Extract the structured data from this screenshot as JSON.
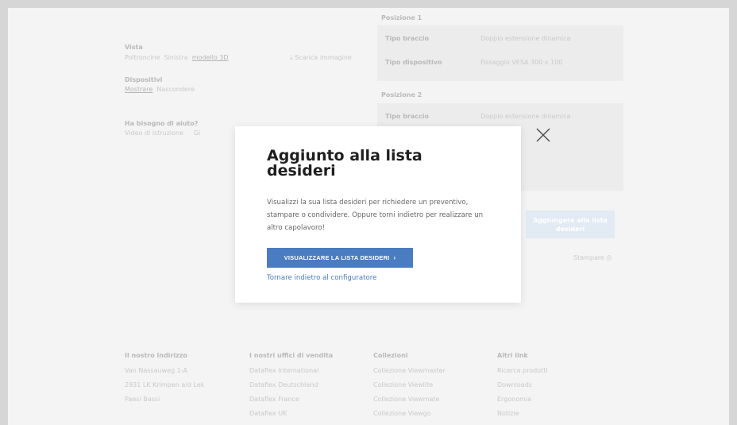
{
  "background": {
    "left": {
      "view_label": "Vista",
      "view_options": [
        "Poltroncine",
        "Sinistra",
        "modello 3D"
      ],
      "download_label": "Scarica immagine",
      "devices_label": "Dispositivi",
      "devices_options": [
        "Mostrare",
        "Nascondere"
      ],
      "help_label": "Ha bisogno di aiuto?",
      "help_options": [
        "Video di istruzione",
        "Gi"
      ]
    },
    "positions": [
      {
        "title": "Posizione 1",
        "rows": [
          {
            "key": "Tipo braccio",
            "value": "Doppio estensione dinamica"
          },
          {
            "key": "Tipo dispositivo",
            "value": "Fissaggio VESA 300 x 100"
          }
        ]
      },
      {
        "title": "Posizione 2",
        "rows": [
          {
            "key": "Tipo braccio",
            "value": "Doppio estensione dinamica"
          }
        ]
      }
    ],
    "add_button": "Aggiungere alla lista desideri",
    "print_label": "Stampare",
    "footer": [
      {
        "title": "Il nostro indirizzo",
        "items": [
          "Van Nassauweg 1-A",
          "2931 LK Krimpen a/d Lek",
          "Paesi Bassi"
        ]
      },
      {
        "title": "I nostri uffici di vendita",
        "items": [
          "Dataflex International",
          "Dataflex Deutschland",
          "Dataflex France",
          "Dataflex UK"
        ]
      },
      {
        "title": "Collezioni",
        "items": [
          "Collezione Viewmaster",
          "Collezione Viewlite",
          "Collezione Viewmate",
          "Collezione Viewgo"
        ]
      },
      {
        "title": "Altri link",
        "items": [
          "Ricerca prodotti",
          "Downloads",
          "Ergonomia",
          "Notizie"
        ]
      }
    ]
  },
  "modal": {
    "title": "Aggiunto alla lista desideri",
    "body": "Visualizzi la sua lista desideri per richiedere un preventivo, stampare o condividere. Oppure torni indietro per realizzare un altro capolavoro!",
    "cta_label": "VISUALIZZARE LA LISTA DESIDERI",
    "back_link": "Tornare indietro al configuratore"
  },
  "colors": {
    "accent": "#4a7cc2",
    "title": "#1f1f1f",
    "body_text": "#666666"
  },
  "icons": {
    "close": "close-icon",
    "cta_chevron": "chevron-right-icon",
    "download": "download-icon",
    "print": "printer-icon"
  }
}
